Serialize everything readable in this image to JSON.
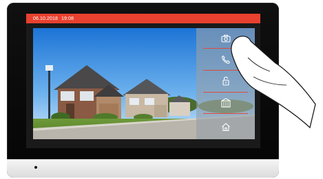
{
  "status_bar": {
    "date": "06.10.2018",
    "time": "19:08",
    "color": "#e9412f"
  },
  "camera_view": {
    "scene": "house-front-camera-image"
  },
  "side_panel": {
    "items": [
      {
        "icon": "camera-icon"
      },
      {
        "icon": "phone-icon"
      },
      {
        "icon": "unlock-icon"
      },
      {
        "icon": "gate-icon"
      },
      {
        "icon": "home-icon"
      }
    ]
  },
  "colors": {
    "accent": "#e9412f",
    "bezel": "#0b0b0b",
    "panel_overlay": "#96a0aa"
  }
}
